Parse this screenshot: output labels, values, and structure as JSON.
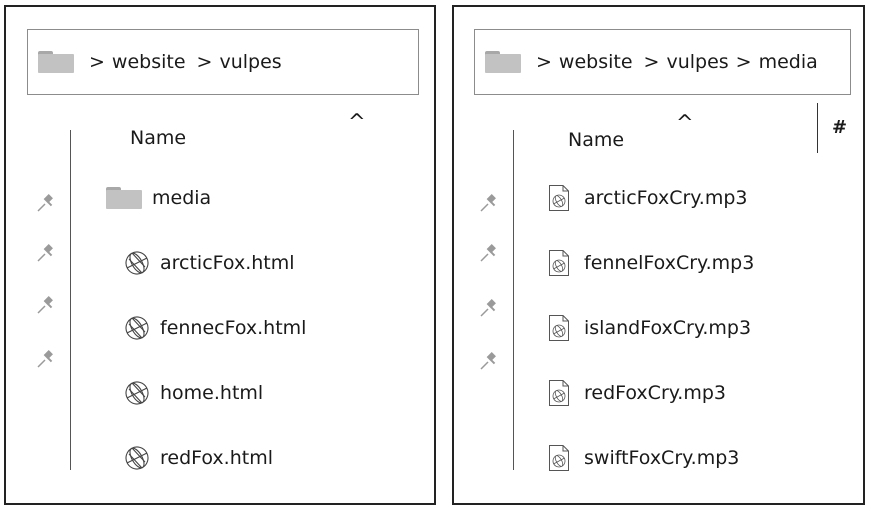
{
  "left_window": {
    "breadcrumb": {
      "segments": [
        "website",
        "vulpes"
      ]
    },
    "column_header": "Name",
    "sort_indicator": "^",
    "items": [
      {
        "label": "media",
        "type": "folder"
      },
      {
        "label": "arcticFox.html",
        "type": "html"
      },
      {
        "label": "fennecFox.html",
        "type": "html"
      },
      {
        "label": "home.html",
        "type": "html"
      },
      {
        "label": "redFox.html",
        "type": "html"
      }
    ]
  },
  "right_window": {
    "breadcrumb": {
      "segments": [
        "website",
        "vulpes",
        "media"
      ]
    },
    "column_header": "Name",
    "sort_indicator": "^",
    "hash_column_header": "#",
    "items": [
      {
        "label": "arcticFoxCry.mp3",
        "type": "mp3"
      },
      {
        "label": "fennelFoxCry.mp3",
        "type": "mp3"
      },
      {
        "label": "islandFoxCry.mp3",
        "type": "mp3"
      },
      {
        "label": "redFoxCry.mp3",
        "type": "mp3"
      },
      {
        "label": "swiftFoxCry.mp3",
        "type": "mp3"
      }
    ]
  },
  "breadcrumb_separator": ">",
  "icons": {
    "folder": "folder-icon",
    "html": "globe-file-icon",
    "mp3": "audio-file-icon",
    "pin": "pin-icon"
  },
  "colors": {
    "folder_fill": "#c2c2c2",
    "pin": "#9a9a9a",
    "border": "#222222"
  }
}
